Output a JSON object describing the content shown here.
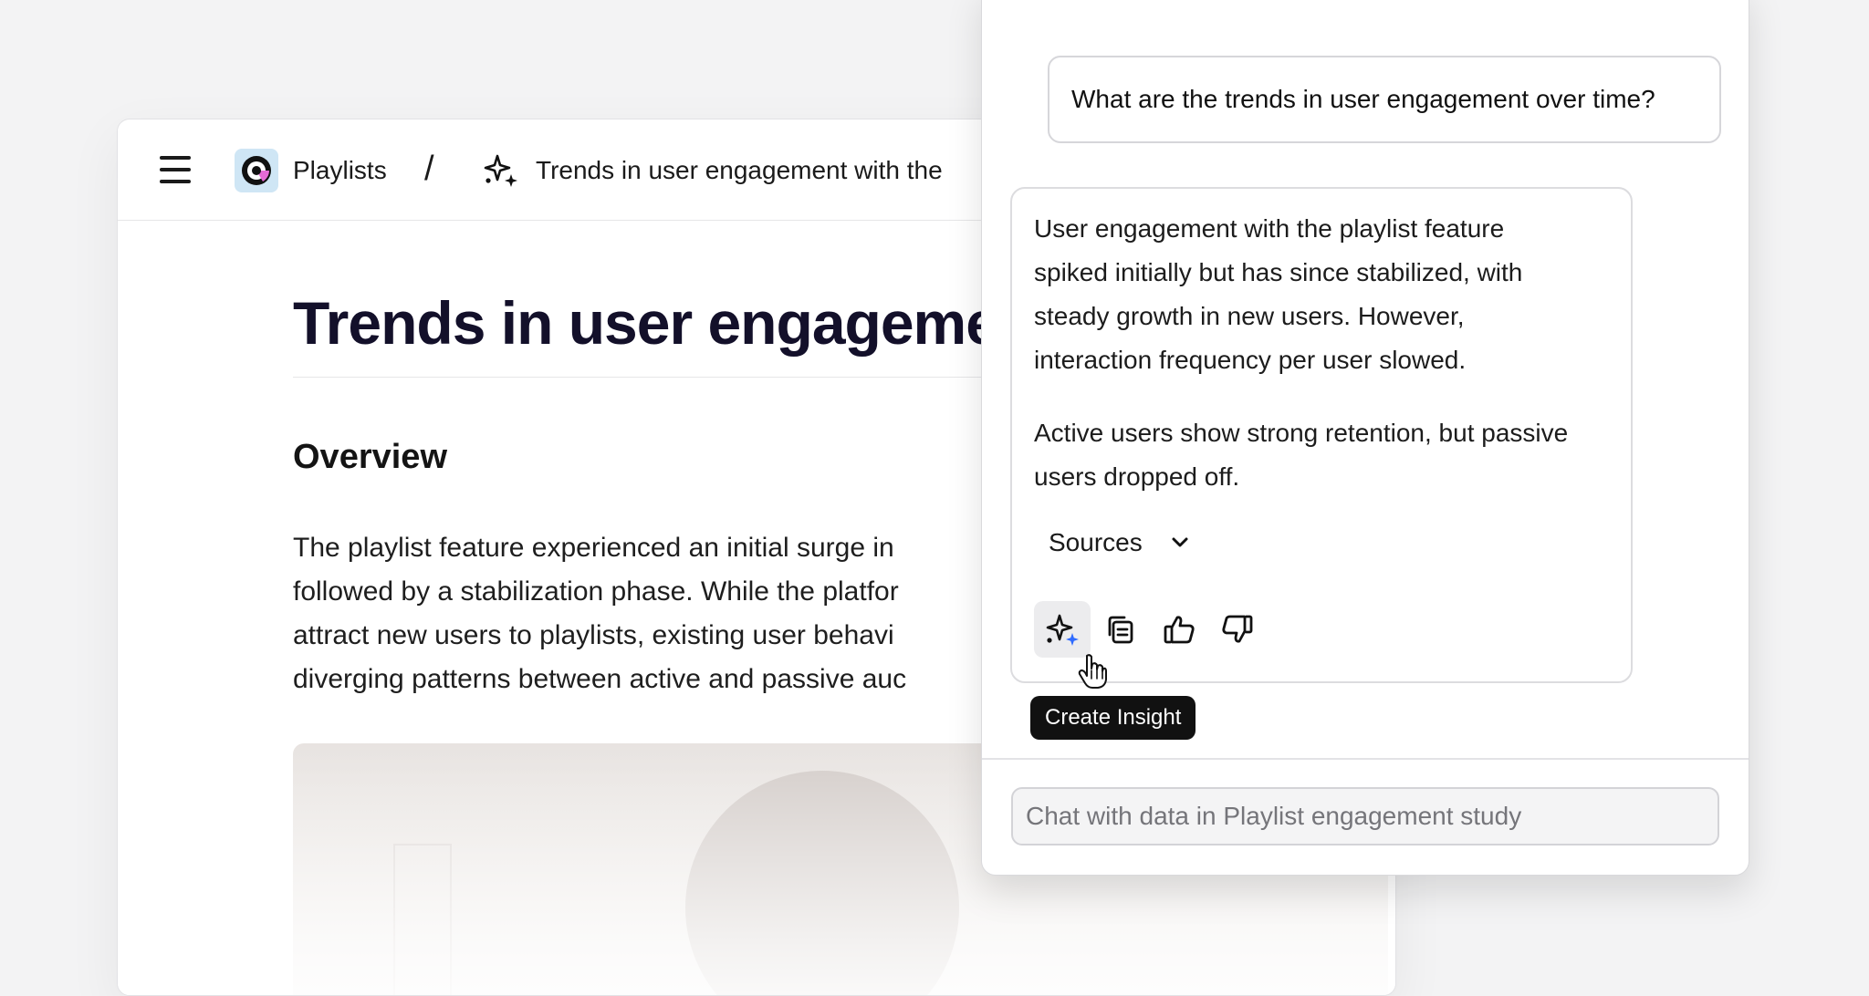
{
  "breadcrumb": {
    "root": "Playlists",
    "separator": "/",
    "current": "Trends in user engagement with the"
  },
  "document": {
    "title": "Trends in user engagemen",
    "overview_heading": "Overview",
    "overview_lines": [
      "The playlist feature experienced an initial surge in",
      "followed by a stabilization phase. While the platfor",
      "attract new users to playlists, existing user behavi",
      "diverging patterns between active and passive auc"
    ]
  },
  "chat": {
    "user_message": "What are the trends in user engagement over time?",
    "response_p1_lines": [
      "User engagement with the playlist feature",
      "spiked initially but has since stabilized, with",
      "steady growth in new users. However,",
      "interaction frequency per user slowed."
    ],
    "response_p2_lines": [
      "Active users show strong retention, but passive",
      "users dropped off."
    ],
    "sources_label": "Sources",
    "tooltip": "Create Insight",
    "input_placeholder": "Chat with data in Playlist engagement study"
  },
  "icons": {
    "menu": "hamburger-menu-icon",
    "logo": "playlists-logo-icon",
    "sparkle": "sparkle-icon",
    "chevron": "chevron-down-icon",
    "create_insight": "create-insight-sparkle-icon",
    "copy": "copy-icon",
    "thumbs_up": "thumbs-up-icon",
    "thumbs_down": "thumbs-down-icon",
    "cursor": "hand-pointer-cursor-icon"
  },
  "colors": {
    "accent_blue": "#2f6bff",
    "logo_bg": "#cfe6f5",
    "logo_pink": "#e56bd6",
    "tooltip_bg": "#111111"
  }
}
